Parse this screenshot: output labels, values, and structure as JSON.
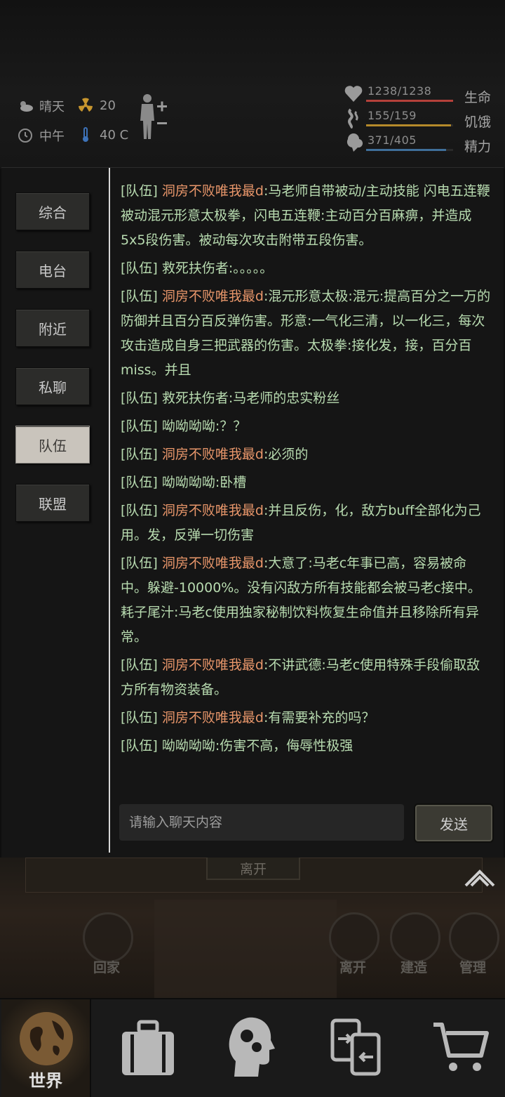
{
  "status": {
    "weather": "晴天",
    "radiation": "20",
    "time_of_day": "中午",
    "temperature": "40 C"
  },
  "vitals": [
    {
      "value": "1238/1238",
      "label": "生命",
      "icon": "heart-icon",
      "color": "#b5403a",
      "fill": 1.0
    },
    {
      "value": "155/159",
      "label": "饥饿",
      "icon": "stomach-icon",
      "color": "#b58a2a",
      "fill": 0.975
    },
    {
      "value": "371/405",
      "label": "精力",
      "icon": "brain-icon",
      "color": "#3f6f9a",
      "fill": 0.916
    }
  ],
  "channels": [
    "综合",
    "电台",
    "附近",
    "私聊",
    "队伍",
    "联盟"
  ],
  "active_channel": "队伍",
  "messages": [
    {
      "channel": "[队伍]",
      "name": "洞房不败唯我最d",
      "name_color": "orange",
      "text": ":马老师自带被动/主动技能 闪电五连鞭被动混元形意太极拳，闪电五连鞭:主动百分百麻痹，并造成5x5段伤害。被动每次攻击附带五段伤害。"
    },
    {
      "channel": "[队伍]",
      "name": "救死扶伤者",
      "name_color": "green",
      "text": ":。。。。。"
    },
    {
      "channel": "[队伍]",
      "name": "洞房不败唯我最d",
      "name_color": "orange",
      "text": ":混元形意太极:混元:提高百分之一万的防御并且百分百反弹伤害。形意:一气化三清，以一化三，每次攻击造成自身三把武器的伤害。太极拳:接化发，接，百分百miss。并且"
    },
    {
      "channel": "[队伍]",
      "name": "救死扶伤者",
      "name_color": "green",
      "text": ":马老师的忠实粉丝"
    },
    {
      "channel": "[队伍]",
      "name": "呦呦呦呦",
      "name_color": "green",
      "text": ":？？"
    },
    {
      "channel": "[队伍]",
      "name": "洞房不败唯我最d",
      "name_color": "orange",
      "text": ":必须的"
    },
    {
      "channel": "[队伍]",
      "name": "呦呦呦呦",
      "name_color": "green",
      "text": ":卧槽"
    },
    {
      "channel": "[队伍]",
      "name": "洞房不败唯我最d",
      "name_color": "orange",
      "text": ":并且反伤，化，敌方buff全部化为己用。发，反弹一切伤害"
    },
    {
      "channel": "[队伍]",
      "name": "洞房不败唯我最d",
      "name_color": "orange",
      "text": ":大意了:马老c年事已高，容易被命中。躲避-10000%。没有闪敌方所有技能都会被马老c接中。耗子尾汁:马老c使用独家秘制饮料恢复生命值并且移除所有异常。"
    },
    {
      "channel": "[队伍]",
      "name": "洞房不败唯我最d",
      "name_color": "orange",
      "text": ":不讲武德:马老c使用特殊手段偷取敌方所有物资装备。"
    },
    {
      "channel": "[队伍]",
      "name": "洞房不败唯我最d",
      "name_color": "orange",
      "text": ":有需要补充的吗？"
    },
    {
      "channel": "[队伍]",
      "name": "呦呦呦呦",
      "name_color": "green",
      "text": ":伤害不高，侮辱性极强"
    }
  ],
  "input": {
    "placeholder": "请输入聊天内容",
    "value": ""
  },
  "send_label": "发送",
  "scene": {
    "leave_label": "离开",
    "actions": [
      {
        "label": "回家",
        "icon": "home-icon"
      },
      {
        "label": "离开",
        "icon": "leave-icon"
      },
      {
        "label": "建造",
        "icon": "hammer-icon"
      },
      {
        "label": "管理",
        "icon": "home-gear-icon"
      }
    ]
  },
  "bottom_nav": [
    {
      "label": "世界",
      "icon": "globe-icon",
      "active": true
    },
    {
      "label": "",
      "icon": "suitcase-icon"
    },
    {
      "label": "",
      "icon": "head-gears-icon"
    },
    {
      "label": "",
      "icon": "exchange-icon"
    },
    {
      "label": "",
      "icon": "cart-icon"
    }
  ]
}
